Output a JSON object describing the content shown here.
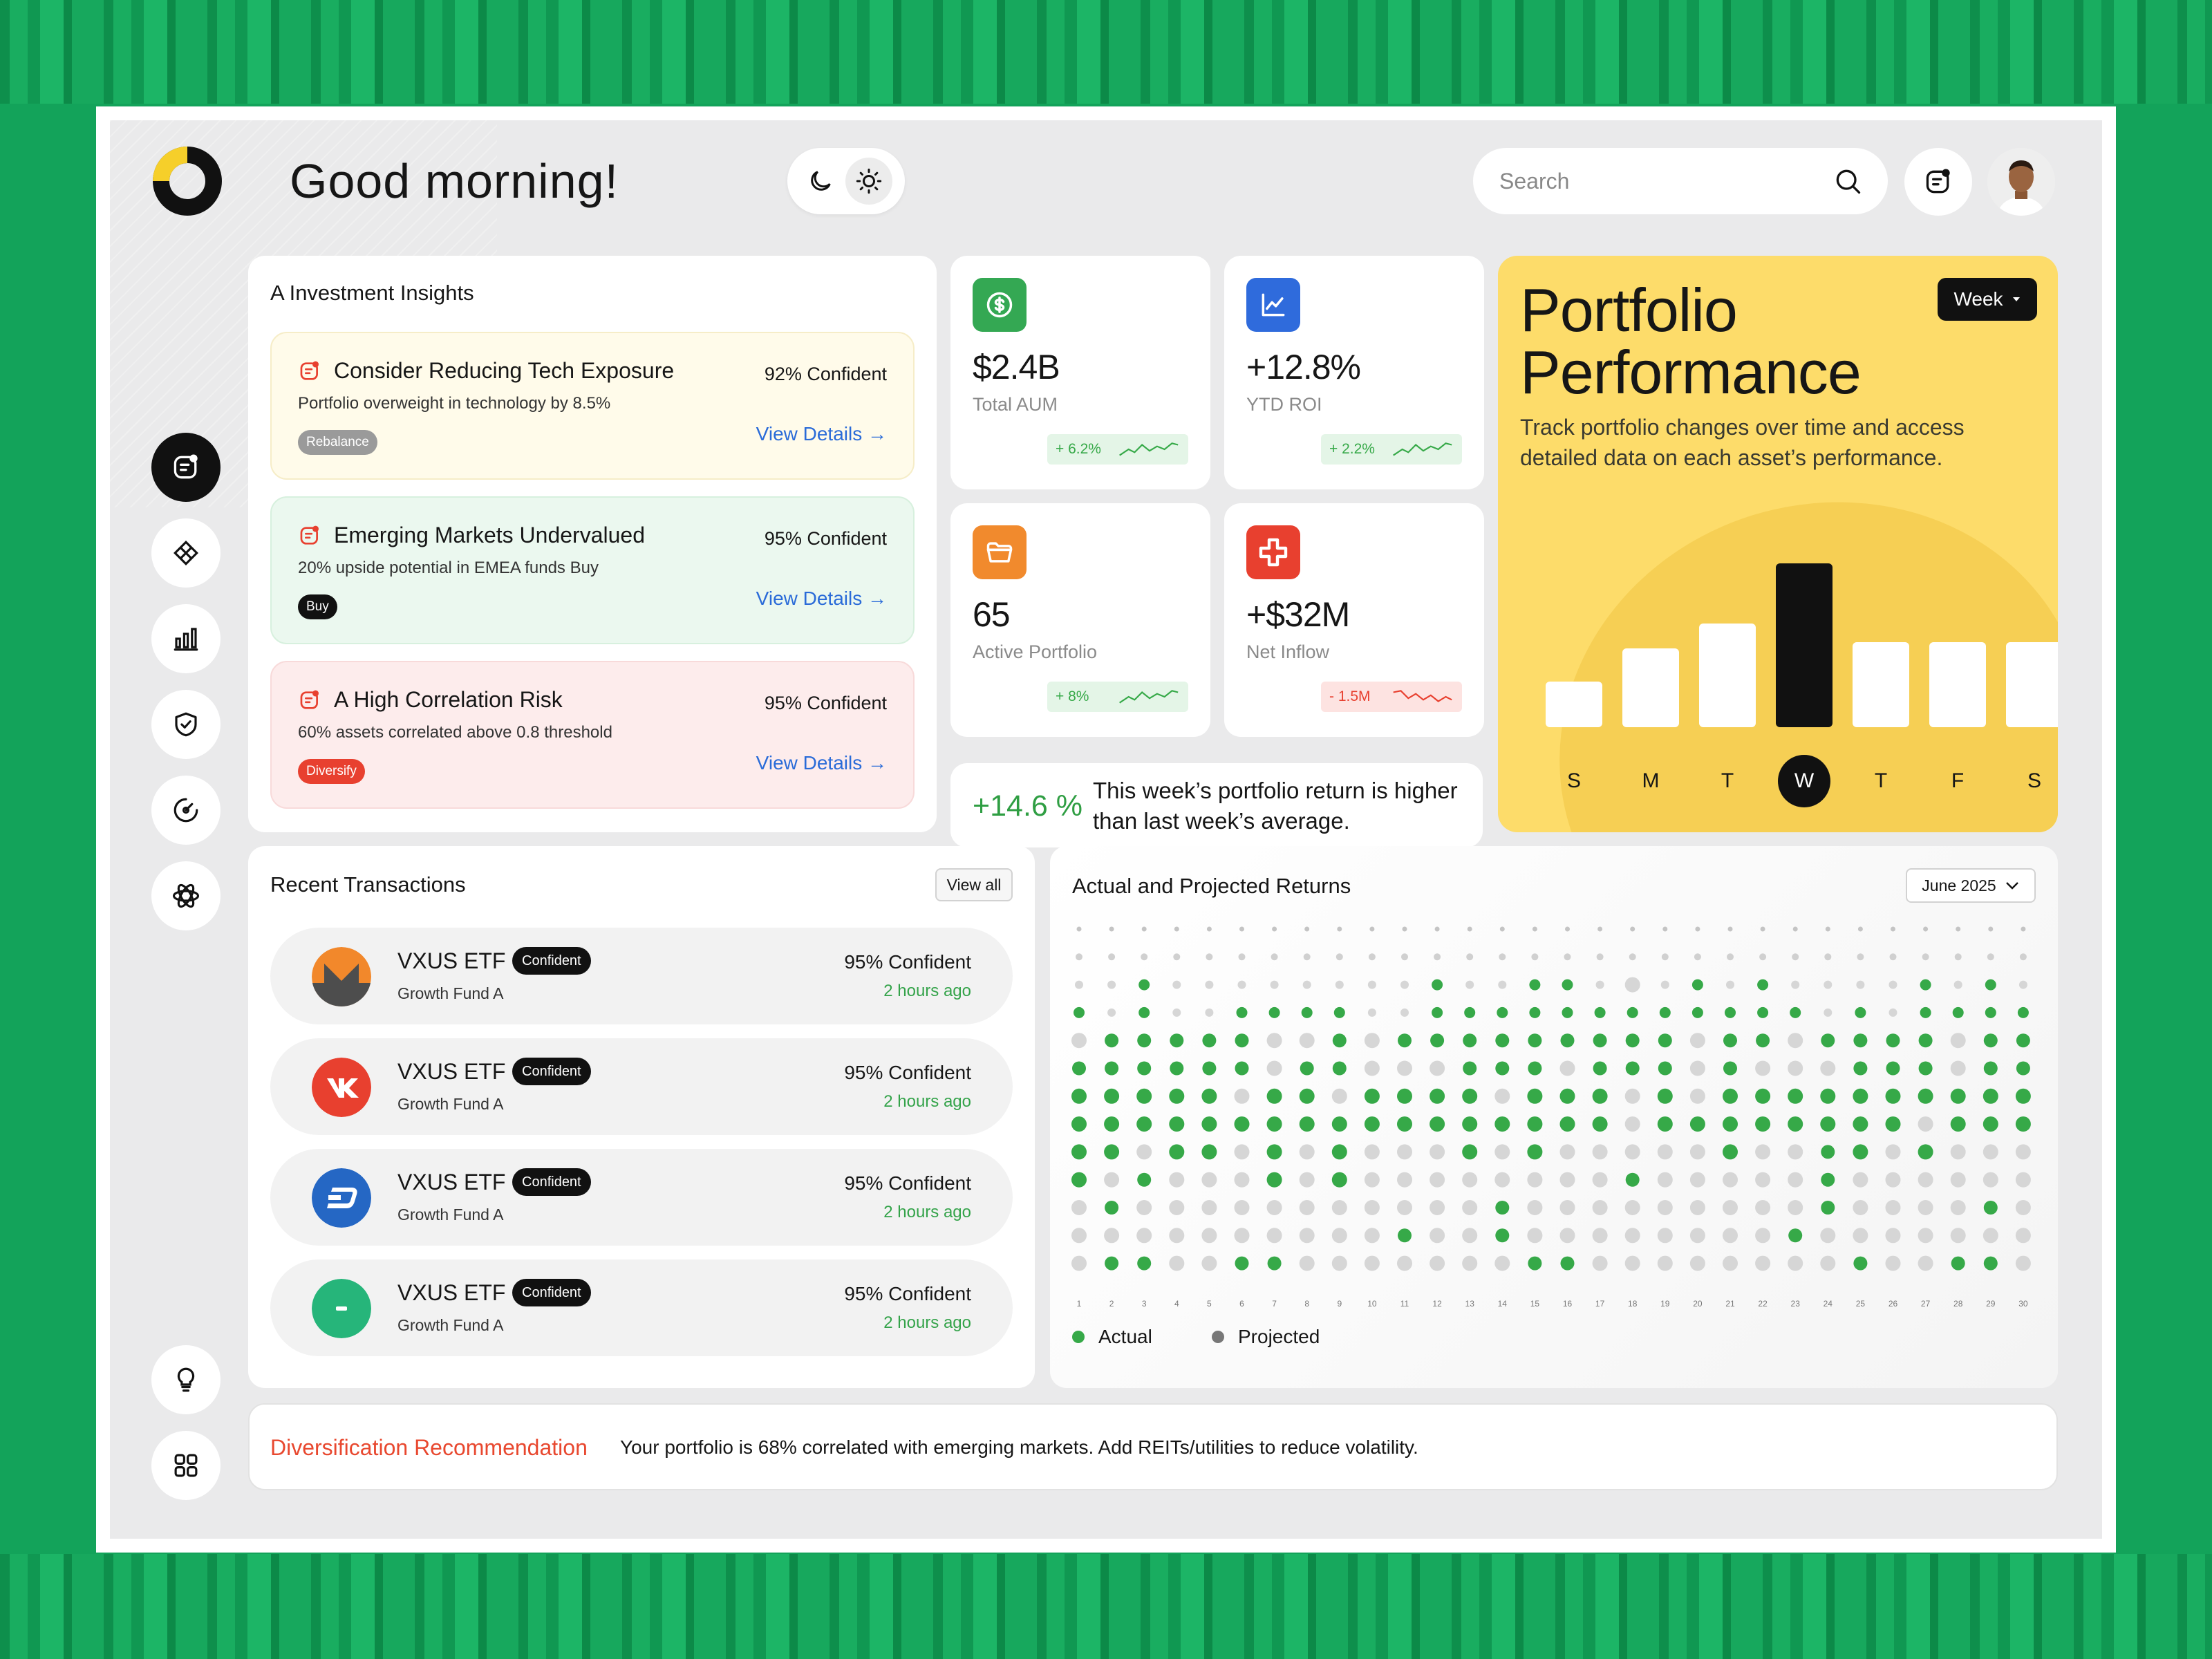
{
  "header": {
    "greeting": "Good morning!",
    "search_placeholder": "Search"
  },
  "insights": {
    "title": "A Investment Insights",
    "items": [
      {
        "title": "Consider Reducing Tech Exposure",
        "desc": "Portfolio overweight in technology by 8.5%",
        "confidence": "92% Confident",
        "tag": "Rebalance",
        "link": "View Details →",
        "bg": "#fffbea",
        "border": "#f6edc8",
        "tag_color": "#9a9a9a"
      },
      {
        "title": "Emerging Markets Undervalued",
        "desc": "20% upside potential in EMEA funds Buy",
        "confidence": "95% Confident",
        "tag": "Buy",
        "link": "View Details →",
        "bg": "#ebf8ef",
        "border": "#d7f0de",
        "tag_color": "#111111"
      },
      {
        "title": "A High Correlation Risk",
        "desc": "60% assets correlated above 0.8 threshold",
        "confidence": "95% Confident",
        "tag": "Diversify",
        "link": "View Details →",
        "bg": "#fdecec",
        "border": "#f8dada",
        "tag_color": "#e8402f"
      }
    ]
  },
  "stats": [
    {
      "value": "$2.4B",
      "label": "Total AUM",
      "change": "+ 6.2%",
      "icon": "dollar-icon",
      "color": "#34a853",
      "trend": "up"
    },
    {
      "value": "+12.8%",
      "label": "YTD ROI",
      "change": "+ 2.2%",
      "icon": "chart-line-icon",
      "color": "#2f6bdc",
      "trend": "up"
    },
    {
      "value": "65",
      "label": "Active Portfolio",
      "change": "+ 8%",
      "icon": "folder-icon",
      "color": "#f18a2d",
      "trend": "up"
    },
    {
      "value": "+$32M",
      "label": "Net Inflow",
      "change": "- 1.5M",
      "icon": "plus-icon",
      "color": "#e8402f",
      "trend": "down"
    }
  ],
  "weekly_return": {
    "value": "+14.6 %",
    "text": "This week’s portfolio return is higher than last week’s average."
  },
  "portfolio": {
    "title": "Portfolio Performance",
    "description": "Track portfolio changes over time and access detailed data on each asset’s performance.",
    "period": "Week",
    "days": [
      "S",
      "M",
      "T",
      "W",
      "T",
      "F",
      "S"
    ],
    "values": [
      0.22,
      0.38,
      0.5,
      0.79,
      0.41,
      0.41,
      0.41
    ],
    "highlight": 3
  },
  "transactions": {
    "title": "Recent Transactions",
    "view_all": "View all",
    "items": [
      {
        "name": "VXUS ETF",
        "badge": "Confident",
        "sub": "Growth Fund A",
        "confidence": "95% Confident",
        "time": "2 hours ago",
        "icon": "monero-icon"
      },
      {
        "name": "VXUS ETF",
        "badge": "Confident",
        "sub": "Growth Fund A",
        "confidence": "95% Confident",
        "time": "2 hours ago",
        "icon": "vk-icon"
      },
      {
        "name": "VXUS ETF",
        "badge": "Confident",
        "sub": "Growth Fund A",
        "confidence": "95% Confident",
        "time": "2 hours ago",
        "icon": "dash-icon"
      },
      {
        "name": "VXUS ETF",
        "badge": "Confident",
        "sub": "Growth Fund A",
        "confidence": "95% Confident",
        "time": "2 hours ago",
        "icon": "tether-icon"
      }
    ]
  },
  "returns": {
    "title": "Actual and Projected Returns",
    "month": "June 2025",
    "legend_actual": "Actual",
    "legend_projected": "Projected",
    "actual_color": "#36a948",
    "projected_color": "#d6d6d6",
    "days": [
      "1",
      "2",
      "3",
      "4",
      "5",
      "6",
      "7",
      "8",
      "9",
      "10",
      "11",
      "12",
      "13",
      "14",
      "15",
      "16",
      "17",
      "18",
      "19",
      "20",
      "21",
      "22",
      "23",
      "24",
      "25",
      "26",
      "27",
      "28",
      "29",
      "30"
    ]
  },
  "recommendation": {
    "title": "Diversification Recommendation",
    "text": "Your portfolio is 68% correlated with emerging markets. Add REITs/utilities to reduce volatility."
  }
}
